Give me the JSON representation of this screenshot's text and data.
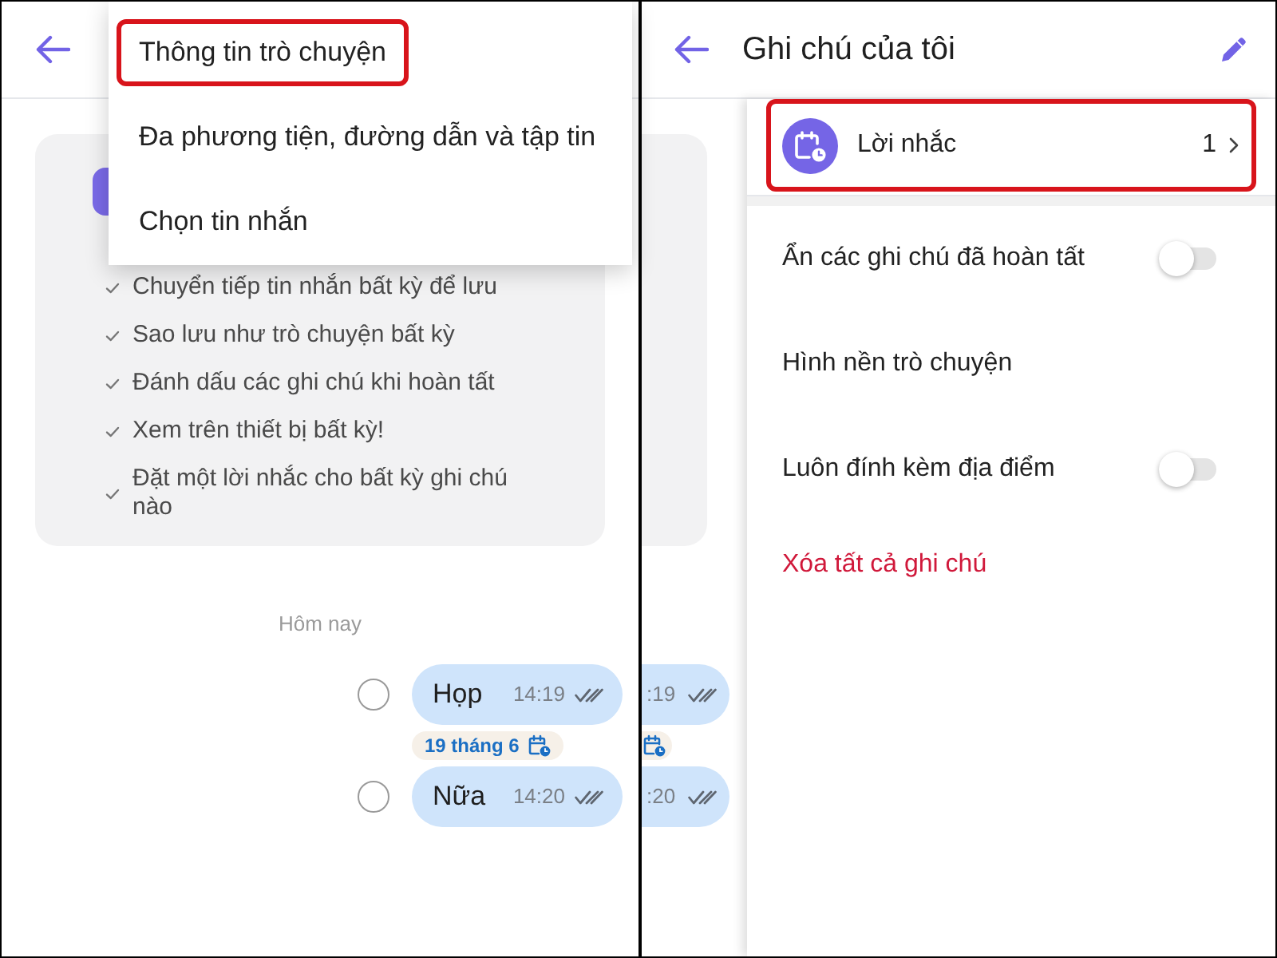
{
  "left_screen": {
    "menu": {
      "items": [
        {
          "label": "Thông tin trò chuyện",
          "highlighted": true
        },
        {
          "label": "Đa phương tiện, đường dẫn và tập tin",
          "highlighted": false
        },
        {
          "label": "Chọn tin nhắn",
          "highlighted": false
        }
      ]
    },
    "intro_card": {
      "features": [
        "Chuyển tiếp tin nhắn bất kỳ để lưu",
        "Sao lưu như trò chuyện bất kỳ",
        "Đánh dấu các ghi chú khi hoàn tất",
        "Xem trên thiết bị bất kỳ!",
        "Đặt một lời nhắc cho bất kỳ ghi chú nào"
      ]
    },
    "date_divider": "Hôm nay",
    "messages": [
      {
        "text": "Họp",
        "time": "14:19",
        "selected": false,
        "reminder": "19 tháng 6"
      },
      {
        "text": "Nữa",
        "time": "14:20",
        "selected": false
      }
    ]
  },
  "right_screen": {
    "title": "Ghi chú của tôi",
    "background_messages": [
      {
        "time": ":19",
        "reminder": true
      },
      {
        "time": ":20"
      }
    ],
    "reminder_row": {
      "label": "Lời nhắc",
      "count": "1",
      "highlighted": true
    },
    "settings": [
      {
        "kind": "toggle",
        "label": "Ẩn các ghi chú đã hoàn tất",
        "on": false
      },
      {
        "kind": "link",
        "label": "Hình nền trò chuyện"
      },
      {
        "kind": "toggle",
        "label": "Luôn đính kèm địa điểm",
        "on": false
      },
      {
        "kind": "danger",
        "label": "Xóa tất cả ghi chú"
      }
    ]
  }
}
